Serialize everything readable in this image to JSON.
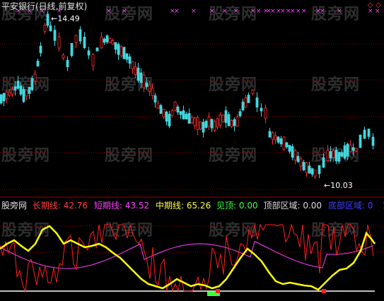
{
  "price_panel": {
    "title": "平安银行(日线,前复权)",
    "high_label": "14.49",
    "low_label": "10.03"
  },
  "indicator_panel": {
    "name": "股旁网",
    "items": [
      {
        "label": "长期线:",
        "value": "42.76",
        "color": "#ff4040"
      },
      {
        "label": "短期线:",
        "value": "43.52",
        "color": "#ff40ff"
      },
      {
        "label": "中期线:",
        "value": "65.26",
        "color": "#ffff40"
      },
      {
        "label": "见顶:",
        "value": "0.00",
        "color": "#40ff40"
      },
      {
        "label": "顶部区域:",
        "value": "0.00",
        "color": "#dddddd"
      },
      {
        "label": "底部区域:",
        "value": "0",
        "color": "#4040ff"
      }
    ],
    "index": "1"
  },
  "watermark": "股旁网",
  "colors": {
    "bg": "#000000",
    "grid": "#8a0000",
    "up": "#ff3030",
    "down": "#40d8e0",
    "yellow": "#ffff00",
    "magenta": "#ff40ff",
    "red_line": "#ff2020"
  }
}
